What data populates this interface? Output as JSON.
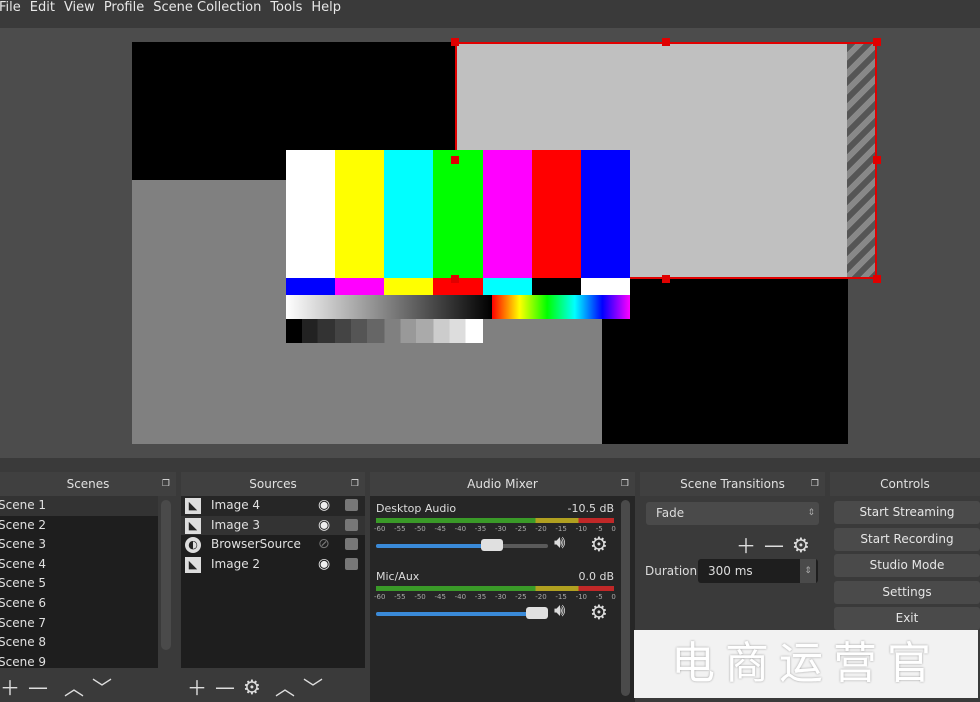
{
  "menu": [
    "File",
    "Edit",
    "View",
    "Profile",
    "Scene Collection",
    "Tools",
    "Help"
  ],
  "preview": {
    "color_bars": [
      "#ffffff",
      "#ffff00",
      "#00ffff",
      "#00ff00",
      "#ff00ff",
      "#ff0000",
      "#0000ff"
    ],
    "bottom_bars": [
      "#0000ff",
      "#ff00ff",
      "#ffff00",
      "#ff0000",
      "#00ffff",
      "#000000",
      "#ffffff"
    ],
    "selection_color": "#e00000"
  },
  "scenes": {
    "title": "Scenes",
    "items": [
      "Scene 1",
      "Scene 2",
      "Scene 3",
      "Scene 4",
      "Scene 5",
      "Scene 6",
      "Scene 7",
      "Scene 8",
      "Scene 9"
    ],
    "selected": "Scene 1"
  },
  "sources": {
    "title": "Sources",
    "items": [
      {
        "name": "Image 4",
        "icon": "image-icon",
        "visible": true
      },
      {
        "name": "Image 3",
        "icon": "image-icon",
        "visible": true
      },
      {
        "name": "BrowserSource",
        "icon": "globe-icon",
        "visible": false
      },
      {
        "name": "Image 2",
        "icon": "image-icon",
        "visible": true
      }
    ]
  },
  "mixer": {
    "title": "Audio Mixer",
    "ticks": [
      "-60",
      "-55",
      "-50",
      "-45",
      "-40",
      "-35",
      "-30",
      "-25",
      "-20",
      "-15",
      "-10",
      "-5",
      "0"
    ],
    "channels": [
      {
        "name": "Desktop Audio",
        "level": "-10.5 dB",
        "volume_fraction": 0.7
      },
      {
        "name": "Mic/Aux",
        "level": "0.0 dB",
        "volume_fraction": 1.0
      }
    ]
  },
  "transitions": {
    "title": "Scene Transitions",
    "selected": "Fade",
    "duration_label": "Duration",
    "duration_value": "300 ms"
  },
  "controls": {
    "title": "Controls",
    "buttons": [
      "Start Streaming",
      "Start Recording",
      "Studio Mode",
      "Settings",
      "Exit"
    ]
  },
  "watermark": "电商运营官"
}
